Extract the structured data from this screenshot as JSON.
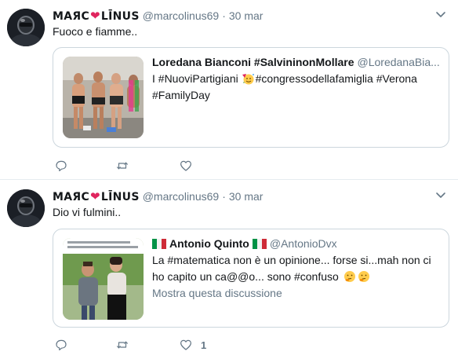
{
  "tweets": [
    {
      "author": {
        "name_part1": "MAЯC",
        "heart": "❤",
        "name_part2": "LĪNUS",
        "handle": "@marcolinus69"
      },
      "dot": "·",
      "time": "30 mar",
      "text": "Fuoco e fiamme..",
      "quote": {
        "name": "Loredana Bianconi #SalvininonMollare",
        "handle": "@LoredanaBia...",
        "text_prefix": "I  #NuoviPartigiani ",
        "text_suffix": "#congressodellafamiglia #Verona #FamilyDay"
      },
      "actions": {
        "reply_icon": "reply-icon",
        "retweet_icon": "retweet-icon",
        "like_icon": "heart-icon",
        "like_count": ""
      }
    },
    {
      "author": {
        "name_part1": "MAЯC",
        "heart": "❤",
        "name_part2": "LĪNUS",
        "handle": "@marcolinus69"
      },
      "dot": "·",
      "time": "30 mar",
      "text": "Dio vi fulmini..",
      "quote": {
        "name": "Antonio Quinto",
        "handle": "@AntonioDvx",
        "text": "La #matematica non è un opinione... forse si...mah non ci ho capito un ca@@o... sono #confuso",
        "show_thread": "Mostra questa discussione"
      },
      "actions": {
        "reply_icon": "reply-icon",
        "retweet_icon": "retweet-icon",
        "like_icon": "heart-icon",
        "like_count": "1"
      }
    }
  ],
  "colors": {
    "text": "#14171a",
    "secondary": "#657786",
    "border": "#ccd6dd",
    "heart": "#e0245e"
  }
}
